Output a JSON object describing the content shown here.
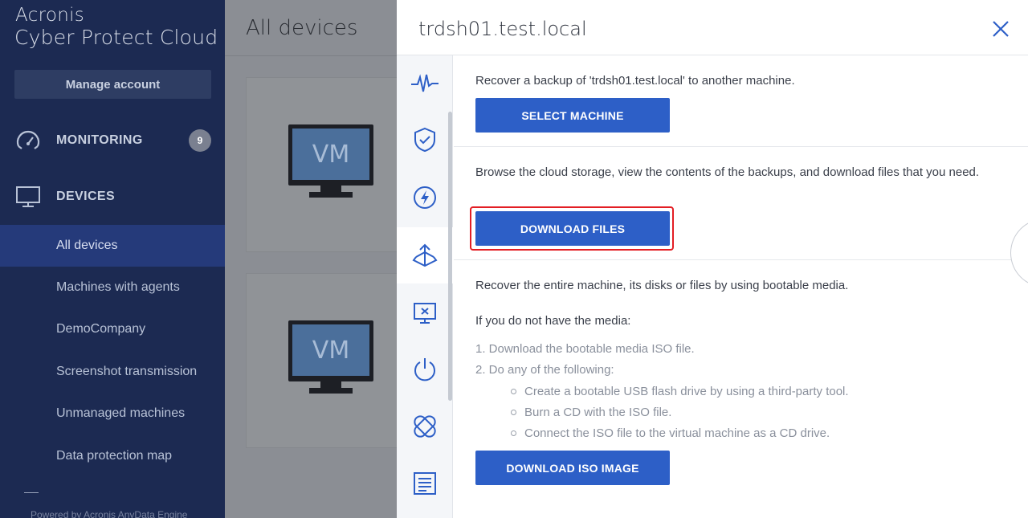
{
  "sidebar": {
    "brand_line1": "Acronis",
    "brand_line2": "Cyber Protect Cloud",
    "manage_account": "Manage account",
    "monitoring": {
      "label": "MONITORING",
      "badge": "9"
    },
    "devices": {
      "label": "DEVICES"
    },
    "items": [
      {
        "label": "All devices",
        "active": true
      },
      {
        "label": "Machines with agents"
      },
      {
        "label": "DemoCompany"
      },
      {
        "label": "Screenshot transmission"
      },
      {
        "label": "Unmanaged machines"
      },
      {
        "label": "Data protection map"
      }
    ],
    "powered_by": "Powered by Acronis AnyData Engine"
  },
  "main": {
    "title": "All devices",
    "cards": [
      {
        "vm_label": "VM"
      },
      {
        "vm_label": "VM"
      }
    ]
  },
  "panel": {
    "title": "trdsh01.test.local",
    "tabs": [
      "activity-icon",
      "shield-icon",
      "lightning-icon",
      "recovery-icon",
      "remote-desktop-icon",
      "power-icon",
      "patch-icon",
      "log-icon"
    ],
    "section1": {
      "text": "Recover a backup of 'trdsh01.test.local' to another machine.",
      "button": "SELECT MACHINE"
    },
    "section2": {
      "text": "Browse the cloud storage, view the contents of the backups, and download files that you need.",
      "button": "DOWNLOAD FILES"
    },
    "section3": {
      "text": "Recover the entire machine, its disks or files by using bootable media.",
      "subhead": "If you do not have the media:",
      "step1": "1. Download the bootable media ISO file.",
      "step2": "2. Do any of the following:",
      "bullets": [
        "Create a bootable USB flash drive by using a third-party tool.",
        "Burn a CD with the ISO file.",
        "Connect the ISO file to the virtual machine as a CD drive."
      ],
      "button": "DOWNLOAD ISO IMAGE"
    }
  },
  "colors": {
    "accent": "#2d5fc7",
    "highlight": "#e31e24",
    "sidebar": "#1c2a52"
  }
}
